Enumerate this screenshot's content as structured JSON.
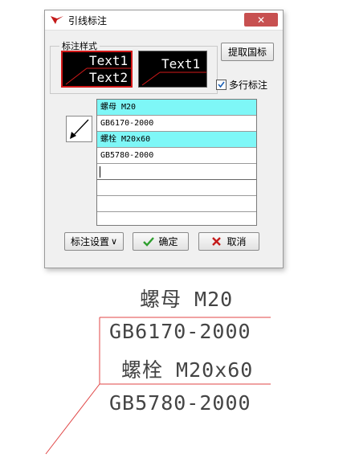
{
  "dialog": {
    "title": "引线标注",
    "close_symbol": "✕",
    "style_group_label": "标注样式",
    "preview_line1": "Text1",
    "preview_line2": "Text2",
    "preview_single": "Text1",
    "fetch_standard_button": "提取国标",
    "multiline_label": "多行标注",
    "multiline_checked": true,
    "list_items": [
      {
        "text": "螺母 M20",
        "highlighted": true
      },
      {
        "text": "GB6170-2000",
        "highlighted": false
      },
      {
        "text": "螺栓 M20x60",
        "highlighted": true
      },
      {
        "text": "GB5780-2000",
        "highlighted": false
      },
      {
        "text": "",
        "highlighted": false
      },
      {
        "text": "",
        "highlighted": false
      },
      {
        "text": "",
        "highlighted": false
      }
    ],
    "settings_button": "标注设置",
    "settings_arrow": "∨",
    "ok_button": "确定",
    "cancel_button": "取消",
    "colors": {
      "highlight": "#7ef7f7",
      "preview_bg": "#000000",
      "preview_border": "#d41a1a",
      "close": "#c75050"
    }
  },
  "drawing": {
    "line1": "螺母 M20",
    "line2": "GB6170-2000",
    "line3": "螺栓 M20x60",
    "line4": "GB5780-2000",
    "frame_color": "#e04444"
  }
}
